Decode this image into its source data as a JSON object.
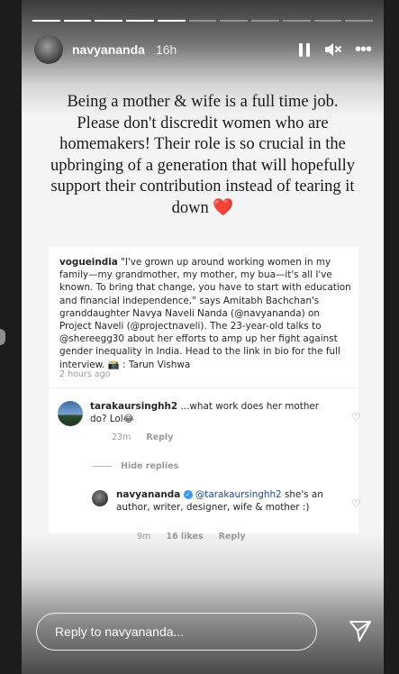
{
  "story": {
    "progress": {
      "total_segments": 11,
      "completed_segments": 5
    },
    "header": {
      "username": "navyananda",
      "timestamp": "16h",
      "icons": [
        "pause-icon",
        "mute-icon",
        "more-icon"
      ]
    },
    "caption": {
      "text": "Being a mother & wife is a full time job. Please don't discredit women who are homemakers! Their role is so crucial in the upbringing of a generation that will hopefully support their contribution instead of tearing it down",
      "emoji": "❤️"
    },
    "screenshot": {
      "post": {
        "author": "vogueindia",
        "text_part1": " \"I've grown up around working women in my family—my grandmother, my mother, my bua—it's all I've known. To bring that change, you have to start with education and financial independence,\" says Amitabh Bachchan's granddaughter Navya Naveli Nanda (",
        "mention1": "@navyananda",
        "text_part2": ") on Project Naveli (",
        "mention2": "@projectnaveli",
        "text_part3": "). The 23-year-old talks to ",
        "mention3": "@shereegg30",
        "text_part4": " about her efforts to amp up her fight against gender inequality in India. Head to the link in bio for the full interview. 📸 : Tarun Vishwa",
        "time": "2 hours ago"
      },
      "comment": {
        "author": "tarakaursinghh2",
        "text": " ...what work does her mother do? Lol😂",
        "time": "23m",
        "reply_label": "Reply"
      },
      "hide_replies_label": "Hide replies",
      "reply": {
        "author": "navyananda",
        "verified_mark": "✓",
        "mention": "@tarakaursinghh2",
        "text": " she's an author, writer, designer, wife & mother :)",
        "time": "9m",
        "likes": "16 likes",
        "reply_label": "Reply"
      }
    },
    "reply_bar": {
      "placeholder": "Reply to navyananda..."
    }
  }
}
